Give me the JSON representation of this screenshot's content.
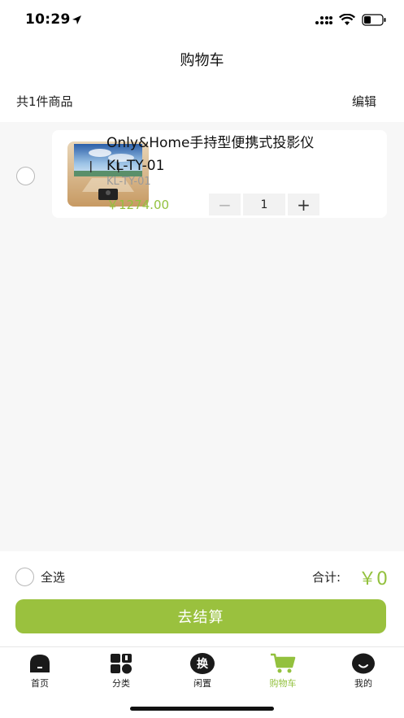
{
  "status_bar": {
    "time": "10:29"
  },
  "nav": {
    "title": "购物车"
  },
  "summary": {
    "count_text": "共1件商品",
    "edit_label": "编辑"
  },
  "cart": {
    "items": [
      {
        "name": "Only&Home手持型便携式投影仪KL-TY-01",
        "code": "KL-TY-01",
        "price": "￥1274.00",
        "quantity": "1",
        "minus_label": "−",
        "plus_label": "+"
      }
    ]
  },
  "footer": {
    "select_all_label": "全选",
    "total_label": "合计:",
    "total_value": "￥0",
    "checkout_label": "去结算"
  },
  "tabs": [
    {
      "label": "首页",
      "icon": "home-icon",
      "active": false
    },
    {
      "label": "分类",
      "icon": "category-icon",
      "active": false
    },
    {
      "label": "闲置",
      "icon": "exchange-icon",
      "icon_text": "换",
      "active": false
    },
    {
      "label": "购物车",
      "icon": "cart-icon",
      "active": true
    },
    {
      "label": "我的",
      "icon": "profile-icon",
      "active": false
    }
  ],
  "colors": {
    "accent": "#93c13e",
    "button": "#9ac13e",
    "background": "#f7f7f7"
  }
}
